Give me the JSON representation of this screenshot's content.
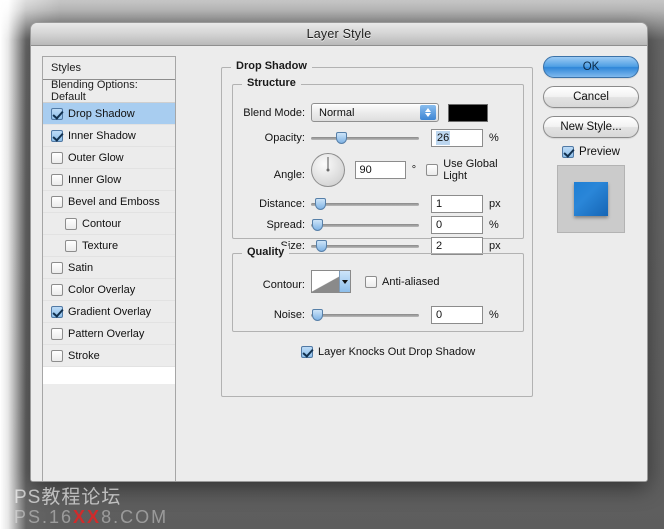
{
  "window": {
    "title": "Layer Style"
  },
  "styles_panel": {
    "header": "Styles",
    "blending_options": "Blending Options: Default",
    "items": [
      {
        "label": "Drop Shadow",
        "checked": true,
        "selected": true,
        "indent": false
      },
      {
        "label": "Inner Shadow",
        "checked": true,
        "selected": false,
        "indent": false
      },
      {
        "label": "Outer Glow",
        "checked": false,
        "selected": false,
        "indent": false
      },
      {
        "label": "Inner Glow",
        "checked": false,
        "selected": false,
        "indent": false
      },
      {
        "label": "Bevel and Emboss",
        "checked": false,
        "selected": false,
        "indent": false
      },
      {
        "label": "Contour",
        "checked": false,
        "selected": false,
        "indent": true
      },
      {
        "label": "Texture",
        "checked": false,
        "selected": false,
        "indent": true
      },
      {
        "label": "Satin",
        "checked": false,
        "selected": false,
        "indent": false
      },
      {
        "label": "Color Overlay",
        "checked": false,
        "selected": false,
        "indent": false
      },
      {
        "label": "Gradient Overlay",
        "checked": true,
        "selected": false,
        "indent": false
      },
      {
        "label": "Pattern Overlay",
        "checked": false,
        "selected": false,
        "indent": false
      },
      {
        "label": "Stroke",
        "checked": false,
        "selected": false,
        "indent": false
      }
    ]
  },
  "drop_shadow": {
    "group_label": "Drop Shadow",
    "structure": {
      "group_label": "Structure",
      "blend_mode": {
        "label": "Blend Mode:",
        "value": "Normal",
        "color": "#000000"
      },
      "opacity": {
        "label": "Opacity:",
        "value": "26",
        "unit": "%",
        "slider_pct": 26
      },
      "angle": {
        "label": "Angle:",
        "value": "90",
        "unit": "°",
        "degrees": 90
      },
      "use_global_light": {
        "label": "Use Global Light",
        "checked": false
      },
      "distance": {
        "label": "Distance:",
        "value": "1",
        "unit": "px",
        "slider_pct": 4
      },
      "spread": {
        "label": "Spread:",
        "value": "0",
        "unit": "%",
        "slider_pct": 1
      },
      "size": {
        "label": "Size:",
        "value": "2",
        "unit": "px",
        "slider_pct": 5
      }
    },
    "quality": {
      "group_label": "Quality",
      "contour": {
        "label": "Contour:"
      },
      "anti_aliased": {
        "label": "Anti-aliased",
        "checked": false
      },
      "noise": {
        "label": "Noise:",
        "value": "0",
        "unit": "%",
        "slider_pct": 1
      }
    },
    "layer_knocks_out": {
      "label": "Layer Knocks Out Drop Shadow",
      "checked": true
    }
  },
  "buttons": {
    "ok": "OK",
    "cancel": "Cancel",
    "new_style": "New Style...",
    "preview": {
      "label": "Preview",
      "checked": true
    }
  },
  "watermark": {
    "line1": "PS教程论坛",
    "line2_pre": "PS.16",
    "line2_red": "XX",
    "line2_post": "8.COM"
  },
  "colors": {
    "selection_blue": "#a8cdf0",
    "default_button_blue": "#2e86d8",
    "preview_square": "#1f7fd4",
    "swatch_black": "#000000"
  }
}
